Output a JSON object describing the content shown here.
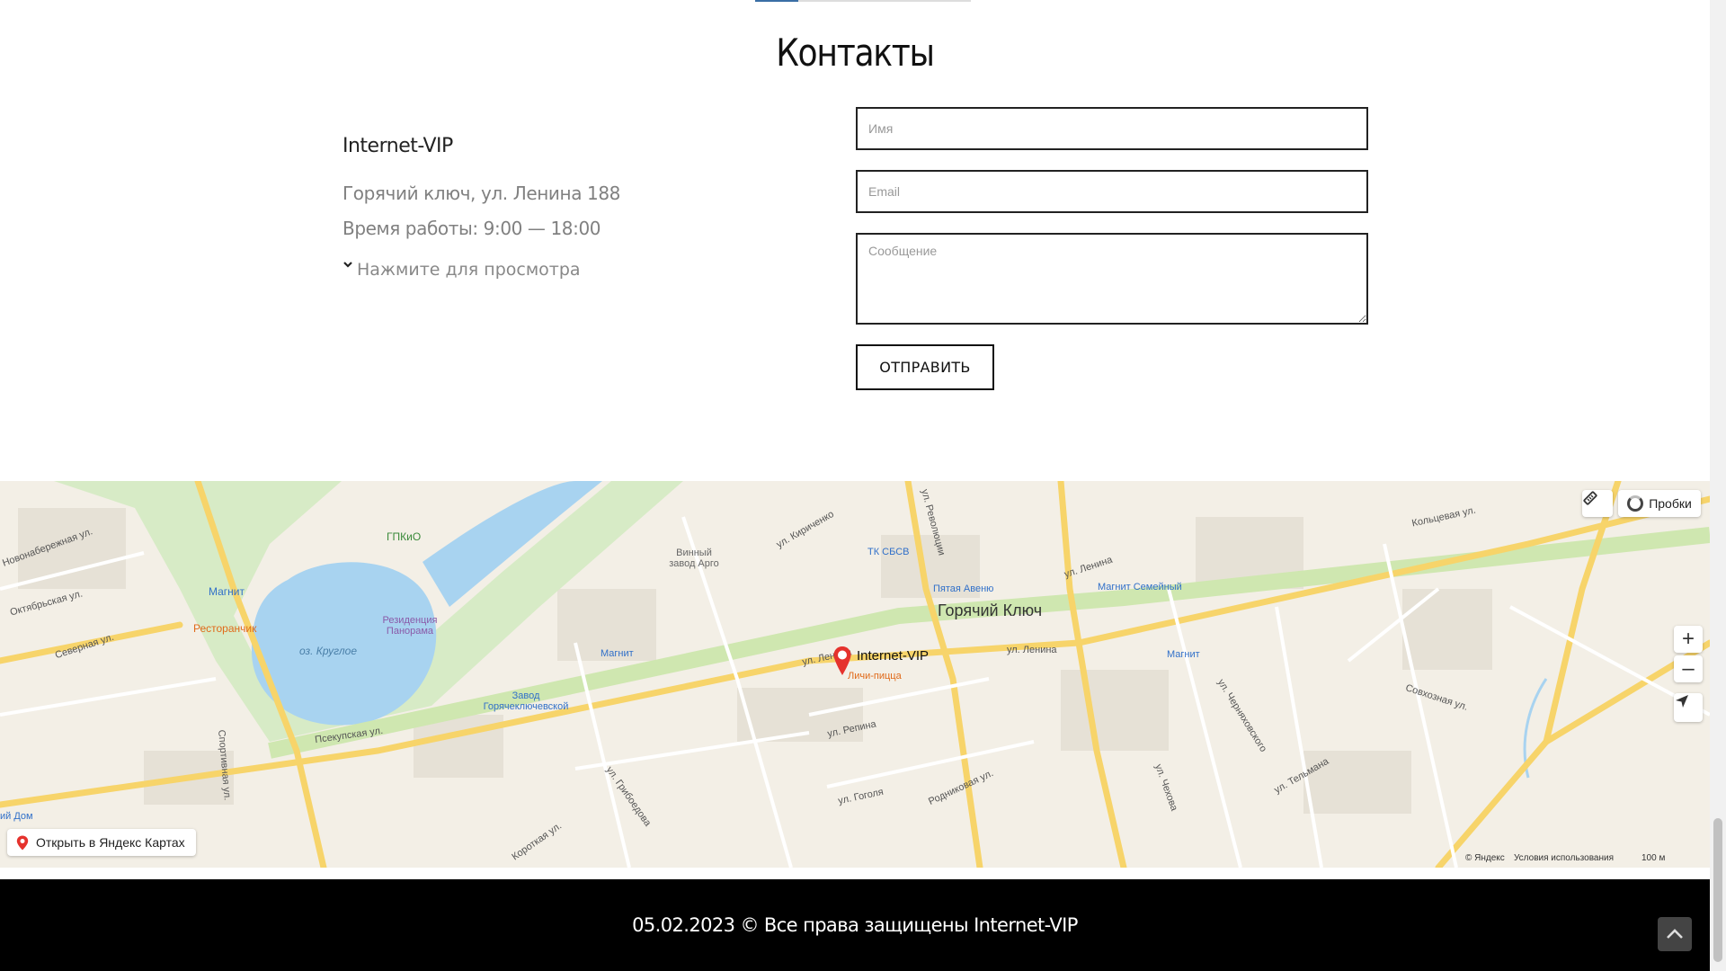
{
  "section": {
    "title": "Контакты"
  },
  "contact": {
    "company": "Internet-VIP",
    "address": "Горячий ключ, ул. Ленина 188",
    "hours": "Время работы: 9:00 — 18:00",
    "toggle_label": "Нажмите для просмотра"
  },
  "form": {
    "name_placeholder": "Имя",
    "email_placeholder": "Email",
    "message_placeholder": "Сообщение",
    "submit_label": "ОТПРАВИТЬ"
  },
  "map": {
    "city": "Горячий Ключ",
    "marker_label": "Internet-VIP",
    "marker_sub": "Личи-пицца",
    "open_label": "Открыть в Яндекс Картах",
    "traffic_label": "Пробки",
    "zoom_in": "+",
    "zoom_out": "–",
    "copyright": "© Яндекс",
    "terms": "Условия использования",
    "scale": "100 м",
    "places": {
      "lake": "оз. Круглое",
      "gpkio": "ГПКиО",
      "magnit1": "Магнит",
      "restoranchik": "Ресторанчик",
      "residence": "Резиденция Панорама",
      "vinzavod": "Винный завод Арго",
      "magnit2": "Магнит",
      "zavod": "Завод Горячеключевской",
      "tksbsv": "ТК СБСВ",
      "pyataya": "Пятая Авеню",
      "magnit_sem": "Магнит Семейный",
      "magnit3": "Магнит",
      "yadom": "ий Дом"
    },
    "streets": {
      "lenina1": "ул. Ленина",
      "lenina2": "ул. Ленина",
      "lenina3": "ул. Ленина",
      "pskupskaya": "Псекупская ул.",
      "repina": "ул. Репина",
      "gogolya": "ул. Гоголя",
      "revolyutsii": "ул. Революции",
      "kirichenko": "ул. Кириченко",
      "chernyakhovskogo": "ул. Черняховского",
      "severnaya": "Северная ул.",
      "oktyabrskaya": "Октябрьская ул.",
      "novonaberezhnaya": "Новонабережная ул.",
      "sovkhoznaya": "Совхозная ул.",
      "koltsevaya": "Кольцевая ул.",
      "tel'mana": "ул. Тельмана",
      "griboedova": "ул. Грибоедова",
      "rodnikovaya": "Родниковая ул.",
      "chekhova": "ул. Чехова",
      "sportivnaya": "Спортивная ул.",
      "korotkaya": "Короткая ул."
    }
  },
  "footer": {
    "text": "05.02.2023 © Все права защищены Internet-VIP"
  },
  "colors": {
    "accent": "#3a6ea5",
    "footer_bg": "#000000",
    "marker": "#e5322d"
  }
}
